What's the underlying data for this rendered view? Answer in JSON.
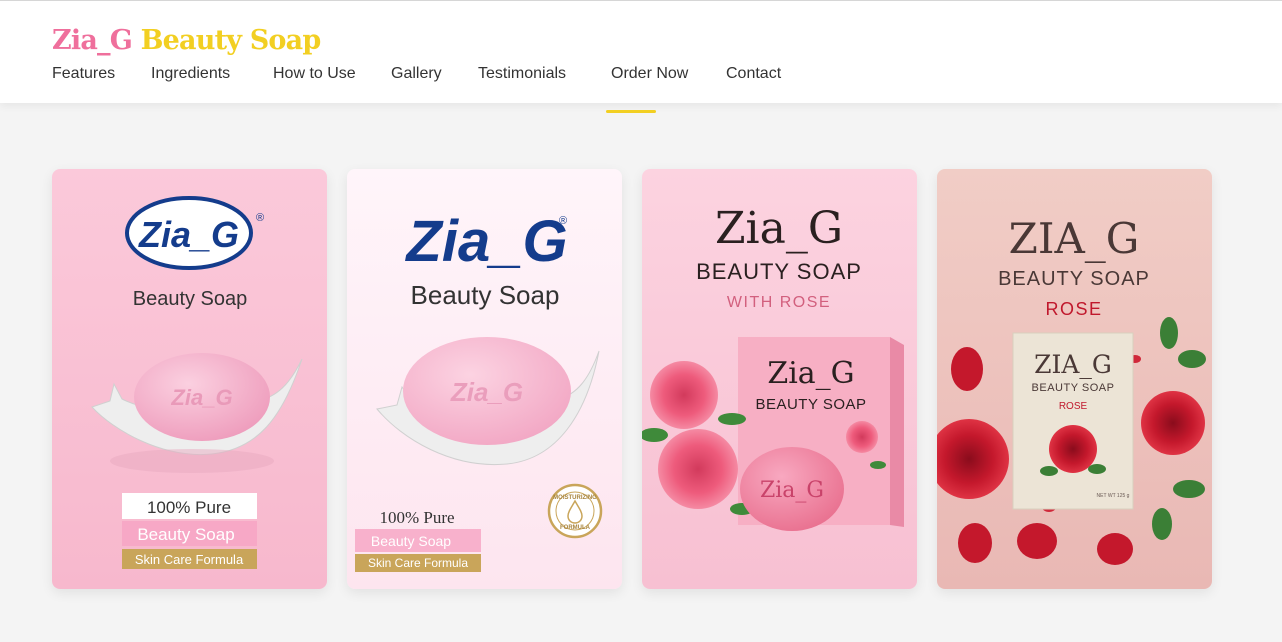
{
  "header": {
    "brand_part1": "Zia_G",
    "brand_part2": "Beauty Soap",
    "nav": [
      {
        "label": "Features"
      },
      {
        "label": "Ingredients"
      },
      {
        "label": "How to Use"
      },
      {
        "label": "Gallery"
      },
      {
        "label": "Testimonials"
      },
      {
        "label": "Order Now",
        "active": true
      },
      {
        "label": "Contact"
      }
    ]
  },
  "colors": {
    "brand_pink": "#ef6f9c",
    "brand_yellow": "#f2cf22",
    "navy": "#143c8c",
    "gold_label": "#c9a55a",
    "rose_red": "#c0182c"
  },
  "gallery": [
    {
      "logo": "Zia_G",
      "registered": "®",
      "subtitle": "Beauty Soap",
      "soap_emboss": "Zia_G",
      "tag1": "100% Pure",
      "tag2": "Beauty Soap",
      "tag3": "Skin Care Formula"
    },
    {
      "logo": "Zia_G",
      "registered": "®",
      "subtitle": "Beauty Soap",
      "soap_emboss": "Zia_G",
      "tag1": "100% Pure",
      "tag2": "Beauty Soap",
      "tag3": "Skin Care Formula",
      "seal_top": "MOISTURIZING",
      "seal_bottom": "FORMULA"
    },
    {
      "logo": "Zia_G",
      "line1": "BEAUTY SOAP",
      "line2": "WITH ROSE",
      "box_title": "Zia_G",
      "box_sub": "BEAUTY SOAP",
      "soap_text": "Zia_G"
    },
    {
      "logo": "ZIA_G",
      "line1": "BEAUTY SOAP",
      "line2": "ROSE",
      "box_title": "ZIA_G",
      "box_sub": "BEAUTY SOAP",
      "box_variant": "ROSE",
      "box_weight": "NET WT 125 g"
    }
  ]
}
